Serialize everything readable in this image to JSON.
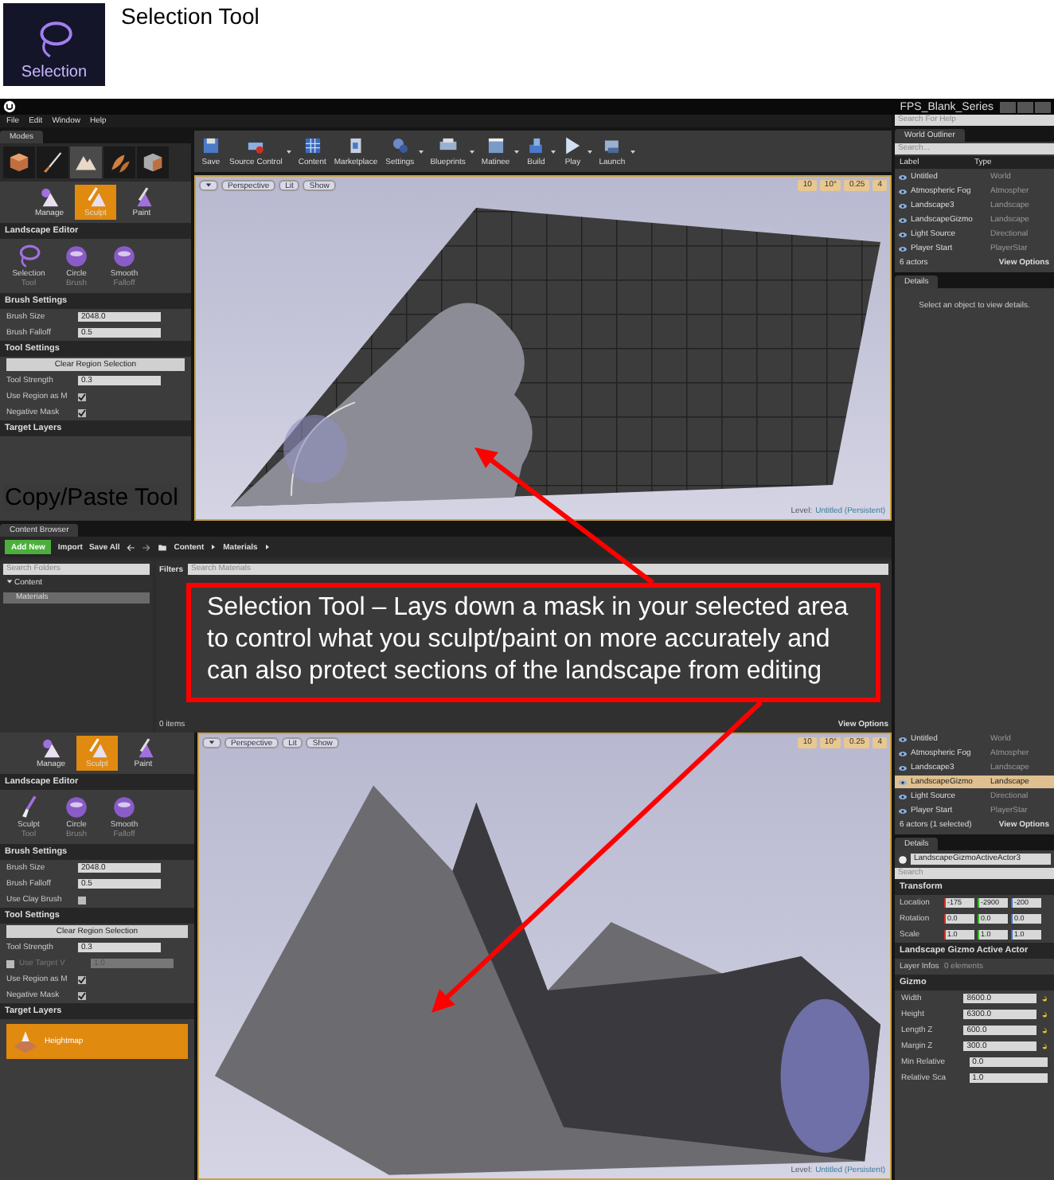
{
  "header": {
    "icon_label": "Selection",
    "title": "Selection Tool"
  },
  "top_editor": {
    "project_title": "FPS_Blank_Series",
    "help_search": {
      "placeholder": "Search For Help"
    },
    "menu": [
      "File",
      "Edit",
      "Window",
      "Help"
    ],
    "modes_tab": "Modes",
    "mode_tabs": [
      {
        "selected": false
      },
      {
        "selected": false
      },
      {
        "selected": true
      },
      {
        "selected": false
      },
      {
        "selected": false
      }
    ],
    "sub_modes": [
      {
        "label": "Manage",
        "selected": false
      },
      {
        "label": "Sculpt",
        "selected": true
      },
      {
        "label": "Paint",
        "selected": false
      }
    ],
    "sections": [
      {
        "title": "Landscape Editor",
        "tools": [
          {
            "name": "Selection",
            "sub": "Tool",
            "kind": "lasso"
          },
          {
            "name": "Circle",
            "sub": "Brush",
            "kind": "sphere"
          },
          {
            "name": "Smooth",
            "sub": "Falloff",
            "kind": "sphere"
          }
        ]
      },
      {
        "title": "Brush Settings",
        "rows": [
          {
            "kind": "number",
            "label": "Brush Size",
            "value": "2048.0"
          },
          {
            "kind": "number",
            "label": "Brush Falloff",
            "value": "0.5"
          }
        ]
      },
      {
        "title": "Tool Settings",
        "rows": [
          {
            "kind": "button",
            "label": "Clear Region Selection"
          },
          {
            "kind": "number",
            "label": "Tool Strength",
            "value": "0.3"
          },
          {
            "kind": "checkbox",
            "label": "Use Region as M",
            "checked": true
          },
          {
            "kind": "checkbox",
            "label": "Negative Mask",
            "checked": true
          }
        ]
      },
      {
        "title": "Target Layers"
      }
    ],
    "toolbar": [
      {
        "label": "Save",
        "has_menu": false
      },
      {
        "label": "Source Control",
        "has_menu": true
      },
      {
        "label": "Content",
        "has_menu": false
      },
      {
        "label": "Marketplace",
        "has_menu": false
      },
      {
        "label": "Settings",
        "has_menu": true
      },
      {
        "label": "Blueprints",
        "has_menu": true
      },
      {
        "label": "Matinee",
        "has_menu": true
      },
      {
        "label": "Build",
        "has_menu": true
      },
      {
        "label": "Play",
        "has_menu": true
      },
      {
        "label": "Launch",
        "has_menu": true
      }
    ],
    "viewport": {
      "view_buttons": [
        "Perspective",
        "Lit",
        "Show"
      ],
      "snap_values": [
        "10",
        "10°",
        "0.25",
        "4"
      ],
      "level_label": "Level:",
      "level_name": "Untitled (Persistent)"
    },
    "outliner": {
      "title": "World Outliner",
      "search": {
        "placeholder": "Search..."
      },
      "columns": [
        "Label",
        "Type"
      ],
      "rows": [
        {
          "label": "Untitled",
          "type": "World",
          "selected": false
        },
        {
          "label": "Atmospheric Fog",
          "type": "Atmospher",
          "selected": false
        },
        {
          "label": "Landscape3",
          "type": "Landscape",
          "selected": false
        },
        {
          "label": "LandscapeGizmo",
          "type": "Landscape",
          "selected": false
        },
        {
          "label": "Light Source",
          "type": "Directional",
          "selected": false
        },
        {
          "label": "Player Start",
          "type": "PlayerStar",
          "selected": false
        }
      ],
      "footer": "6 actors",
      "view_options": "View Options"
    },
    "details": {
      "title": "Details",
      "message": "Select an object to view details."
    },
    "content_browser": {
      "title": "Content Browser",
      "add_new": "Add New",
      "import": "Import",
      "save_all": "Save All",
      "path": [
        "Content",
        "Materials"
      ],
      "folder_search": {
        "placeholder": "Search Folders"
      },
      "tree": [
        {
          "label": "Content",
          "expanded": true,
          "selected": false,
          "children": [
            {
              "label": "Materials",
              "selected": true
            }
          ]
        }
      ],
      "filters": "Filters",
      "asset_search": {
        "placeholder": "Search Materials"
      },
      "item_count": "0 items",
      "view_options": "View Options"
    }
  },
  "overlay_label": "Copy/Paste Tool",
  "callout": "Selection Tool – Lays down a mask in your selected area to control what you sculpt/paint on more accurately and can also protect sections of the landscape from editing",
  "bottom_editor": {
    "sub_modes": [
      {
        "label": "Manage",
        "selected": false
      },
      {
        "label": "Sculpt",
        "selected": true
      },
      {
        "label": "Paint",
        "selected": false
      }
    ],
    "sections": [
      {
        "title": "Landscape Editor",
        "tools": [
          {
            "name": "Sculpt",
            "sub": "Tool",
            "kind": "brush"
          },
          {
            "name": "Circle",
            "sub": "Brush",
            "kind": "sphere"
          },
          {
            "name": "Smooth",
            "sub": "Falloff",
            "kind": "sphere"
          }
        ]
      },
      {
        "title": "Brush Settings",
        "rows": [
          {
            "kind": "number",
            "label": "Brush Size",
            "value": "2048.0"
          },
          {
            "kind": "number",
            "label": "Brush Falloff",
            "value": "0.5"
          },
          {
            "kind": "checkbox",
            "label": "Use Clay Brush",
            "checked": false
          }
        ]
      },
      {
        "title": "Tool Settings",
        "rows": [
          {
            "kind": "button",
            "label": "Clear Region Selection"
          },
          {
            "kind": "number",
            "label": "Tool Strength",
            "value": "0.3"
          },
          {
            "kind": "check_number",
            "label": "Use Target V",
            "value": "1.0",
            "checked": false,
            "disabled": true
          },
          {
            "kind": "checkbox",
            "label": "Use Region as M",
            "checked": true
          },
          {
            "kind": "checkbox",
            "label": "Negative Mask",
            "checked": true
          }
        ]
      },
      {
        "title": "Target Layers",
        "layers": [
          {
            "name": "Heightmap",
            "selected": true
          }
        ]
      }
    ],
    "viewport": {
      "view_buttons": [
        "Perspective",
        "Lit",
        "Show"
      ],
      "snap_values": [
        "10",
        "10°",
        "0.25",
        "4"
      ],
      "level_label": "Level:",
      "level_name": "Untitled (Persistent)"
    },
    "outliner": {
      "rows": [
        {
          "label": "Untitled",
          "type": "World",
          "selected": false
        },
        {
          "label": "Atmospheric Fog",
          "type": "Atmospher",
          "selected": false
        },
        {
          "label": "Landscape3",
          "type": "Landscape",
          "selected": false
        },
        {
          "label": "LandscapeGizmo",
          "type": "Landscape",
          "selected": true
        },
        {
          "label": "Light Source",
          "type": "Directional",
          "selected": false
        },
        {
          "label": "Player Start",
          "type": "PlayerStar",
          "selected": false
        }
      ],
      "footer": "6 actors (1 selected)",
      "view_options": "View Options"
    },
    "details": {
      "title": "Details",
      "actor_name": "LandscapeGizmoActiveActor3",
      "search": {
        "placeholder": "Search"
      },
      "sections": [
        {
          "title": "Transform",
          "rows": [
            {
              "kind": "vector",
              "label": "Location",
              "values": [
                "-175",
                "-2900",
                "-200"
              ]
            },
            {
              "kind": "vector",
              "label": "Rotation",
              "values": [
                "0.0",
                "0.0",
                "0.0"
              ]
            },
            {
              "kind": "vector",
              "label": "Scale",
              "values": [
                "1.0",
                "1.0",
                "1.0"
              ]
            }
          ]
        },
        {
          "title": "Landscape Gizmo Active Actor",
          "rows": [
            {
              "kind": "info",
              "label": "Layer Infos",
              "value": "0 elements"
            }
          ]
        },
        {
          "title": "Gizmo",
          "rows": [
            {
              "kind": "number",
              "label": "Width",
              "value": "8600.0",
              "reset": true
            },
            {
              "kind": "number",
              "label": "Height",
              "value": "6300.0",
              "reset": true
            },
            {
              "kind": "number",
              "label": "Length Z",
              "value": "600.0",
              "reset": true
            },
            {
              "kind": "number",
              "label": "Margin Z",
              "value": "300.0",
              "reset": true
            },
            {
              "kind": "number",
              "label": "Min Relative",
              "value": "0.0",
              "reset": false
            },
            {
              "kind": "number",
              "label": "Relative Sca",
              "value": "1.0",
              "reset": false
            }
          ]
        }
      ]
    }
  }
}
